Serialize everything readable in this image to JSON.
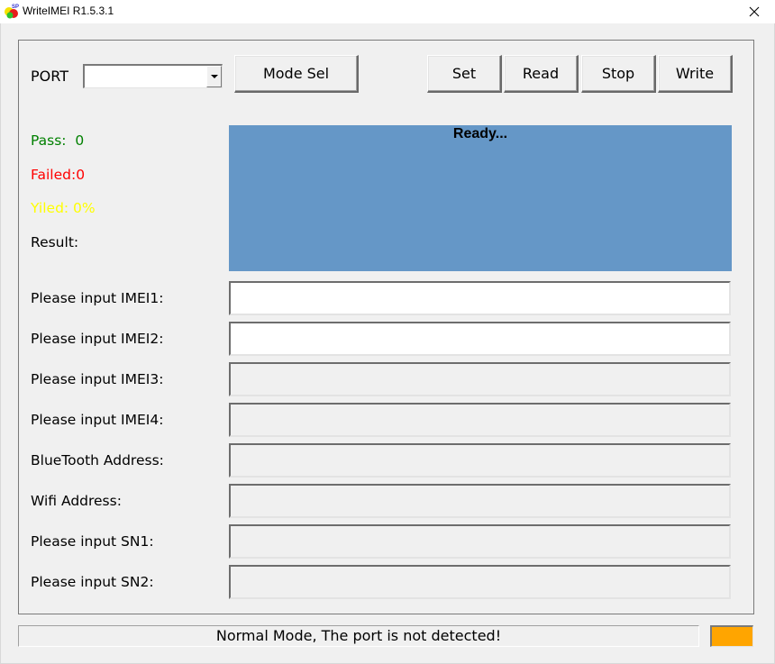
{
  "window": {
    "title": "WriteIMEI R1.5.3.1",
    "icon": "app-logo-icon",
    "close_icon": "close-icon"
  },
  "toolbar": {
    "port_label": "PORT",
    "port_value": "",
    "mode_sel_label": "Mode Sel",
    "set_label": "Set",
    "read_label": "Read",
    "stop_label": "Stop",
    "write_label": "Write"
  },
  "stats": {
    "pass_label": "Pass:  0",
    "failed_label": "Failed:0",
    "yield_label": "Yiled: 0%",
    "result_label": "Result:",
    "pass_color": "#008000",
    "failed_color": "#ff0000",
    "yield_color": "#ffff00"
  },
  "result_panel": {
    "text": "Ready...",
    "color": "#6597c7"
  },
  "fields": [
    {
      "label": "Please input IMEI1:",
      "value": "",
      "enabled": true
    },
    {
      "label": "Please input IMEI2:",
      "value": "",
      "enabled": true
    },
    {
      "label": "Please input IMEI3:",
      "value": "",
      "enabled": false
    },
    {
      "label": "Please input IMEI4:",
      "value": "",
      "enabled": false
    },
    {
      "label": "BlueTooth Address:",
      "value": "",
      "enabled": false
    },
    {
      "label": "Wifi Address:",
      "value": "",
      "enabled": false
    },
    {
      "label": "Please input SN1:",
      "value": "",
      "enabled": false
    },
    {
      "label": "Please input SN2:",
      "value": "",
      "enabled": false
    }
  ],
  "status_bar": {
    "text": "Normal Mode, The port is not detected!",
    "indicator_color": "#ffa500"
  }
}
